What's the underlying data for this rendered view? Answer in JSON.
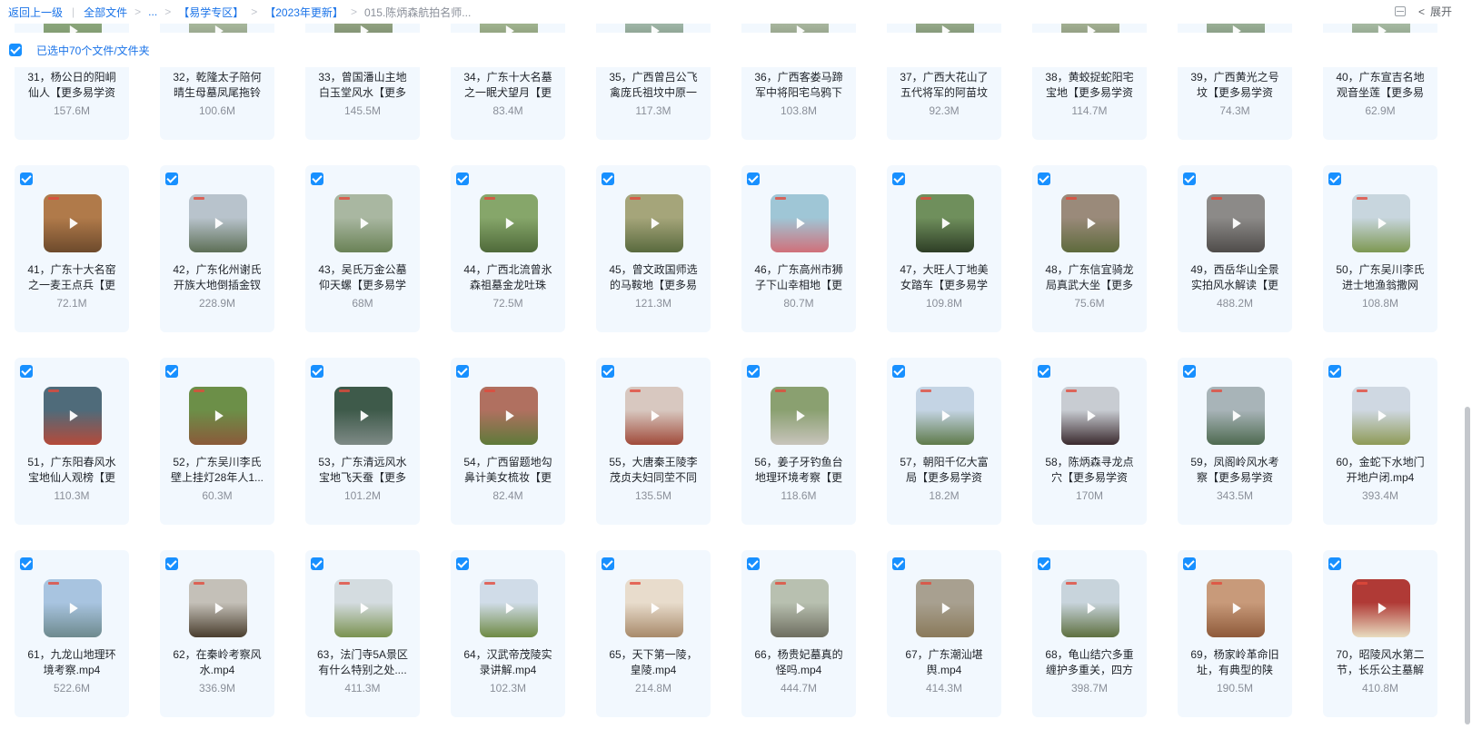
{
  "breadcrumb": {
    "back": "返回上一级",
    "all_files": "全部文件",
    "ellipsis": "...",
    "folder1": "【易学专区】",
    "folder2": "【2023年更新】",
    "current": "015.陈炳森航拍名师..."
  },
  "toolbar": {
    "expand_label": "展开",
    "list_icon": "list-view-icon",
    "chevron_icon": "chevron-left-icon"
  },
  "selection": {
    "label": "已选中70个文件/文件夹"
  },
  "icons": {
    "checkbox": "check-icon",
    "play": "play-icon"
  },
  "files": [
    {
      "name": "31，杨公日的阳峒仙人【更多易学资",
      "size": "157.6M",
      "colors": [
        "#8aa57a",
        "#6b7d5a"
      ]
    },
    {
      "name": "32，乾隆太子陪何晴生母墓凤尾拖铃",
      "size": "100.6M",
      "colors": [
        "#a5b59a",
        "#777e6c"
      ]
    },
    {
      "name": "33，曾国潘山主地白玉堂风水【更多",
      "size": "145.5M",
      "colors": [
        "#8fa07f",
        "#5d6b52"
      ]
    },
    {
      "name": "34，广东十大名墓之一眠犬望月【更",
      "size": "83.4M",
      "colors": [
        "#9eb18d",
        "#6c7a58"
      ]
    },
    {
      "name": "35，广西曾吕公飞禽庞氏祖坟中原一",
      "size": "117.3M",
      "colors": [
        "#9db4a5",
        "#627560"
      ]
    },
    {
      "name": "36，广西客娄马蹄军中将阳宅乌鸦下",
      "size": "103.8M",
      "colors": [
        "#a6b49c",
        "#6f7b64"
      ]
    },
    {
      "name": "37，广西大花山了五代将军的阿苗坟",
      "size": "92.3M",
      "colors": [
        "#93a787",
        "#5a6a50"
      ]
    },
    {
      "name": "38，黄蛟捉蛇阳宅宝地【更多易学资",
      "size": "114.7M",
      "colors": [
        "#a0ad90",
        "#6a735c"
      ]
    },
    {
      "name": "39，广西黄光之号坟【更多易学资",
      "size": "74.3M",
      "colors": [
        "#98ad94",
        "#60725e"
      ]
    },
    {
      "name": "40，广东宣吉名地观音坐莲【更多易",
      "size": "62.9M",
      "colors": [
        "#a4b8a0",
        "#6d7d68"
      ]
    },
    {
      "name": "41，广东十大名窑之一麦王点兵【更",
      "size": "72.1M",
      "colors": [
        "#b07a4a",
        "#6d4a2c"
      ]
    },
    {
      "name": "42，广东化州谢氏开族大地倒插金钗",
      "size": "228.9M",
      "colors": [
        "#b8c3cc",
        "#5d6f56"
      ]
    },
    {
      "name": "43，吴氏万金公墓仰天螺【更多易学",
      "size": "68M",
      "colors": [
        "#a9b7a1",
        "#6a8256"
      ]
    },
    {
      "name": "44，广西北流曾氷森祖墓金龙吐珠",
      "size": "72.5M",
      "colors": [
        "#86a66a",
        "#4f6a3a"
      ]
    },
    {
      "name": "45，曾文政国师选的马鞍地【更多易",
      "size": "121.3M",
      "colors": [
        "#a5a57a",
        "#596a3e"
      ]
    },
    {
      "name": "46，广东高州市狮子下山幸相地【更",
      "size": "80.7M",
      "colors": [
        "#9fc6d6",
        "#d0707a"
      ]
    },
    {
      "name": "47，大旺人丁地美女踏车【更多易学",
      "size": "109.8M",
      "colors": [
        "#6f8f5c",
        "#2e3e26"
      ]
    },
    {
      "name": "48，广东信宜骑龙局真武大坐【更多",
      "size": "75.6M",
      "colors": [
        "#9a8a7a",
        "#5e6a3c"
      ]
    },
    {
      "name": "49，西岳华山全景实拍风水解读【更",
      "size": "488.2M",
      "colors": [
        "#8c8a88",
        "#4f4c4a"
      ]
    },
    {
      "name": "50，广东吴川李氏进士地渔翁撒网",
      "size": "108.8M",
      "colors": [
        "#c8d6de",
        "#7d9852"
      ]
    },
    {
      "name": "51，广东阳春风水宝地仙人观榜【更",
      "size": "110.3M",
      "colors": [
        "#4f6b7a",
        "#b54a3a"
      ]
    },
    {
      "name": "52，广东吴川李氏壁上挂灯28年人1...",
      "size": "60.3M",
      "colors": [
        "#6c8f48",
        "#8a5a3a"
      ]
    },
    {
      "name": "53，广东清远风水宝地飞天蚕【更多",
      "size": "101.2M",
      "colors": [
        "#3e5a4a",
        "#7e8a86"
      ]
    },
    {
      "name": "54，广西留题地勾鼻计美女梳妆【更",
      "size": "82.4M",
      "colors": [
        "#b07060",
        "#5e7a3a"
      ]
    },
    {
      "name": "55，大唐秦王陵李茂贞夫妇同茔不同",
      "size": "135.5M",
      "colors": [
        "#d8c8c0",
        "#a04a3a"
      ]
    },
    {
      "name": "56，姜子牙钓鱼台地理环境考察【更",
      "size": "118.6M",
      "colors": [
        "#8aa070",
        "#c8c4bc"
      ]
    },
    {
      "name": "57，朝阳千亿大富局【更多易学资",
      "size": "18.2M",
      "colors": [
        "#c4d4e4",
        "#5e7a4a"
      ]
    },
    {
      "name": "58，陈炳森寻龙点穴【更多易学资",
      "size": "170M",
      "colors": [
        "#c8ccd2",
        "#3a2a2e"
      ]
    },
    {
      "name": "59，凤阁岭风水考察【更多易学资",
      "size": "343.5M",
      "colors": [
        "#a8b4b8",
        "#4e6a50"
      ]
    },
    {
      "name": "60，金蛇下水地门开地户闭.mp4",
      "size": "393.4M",
      "colors": [
        "#cfd8e2",
        "#8e9a56"
      ]
    },
    {
      "name": "61，九龙山地理环境考察.mp4",
      "size": "522.6M",
      "colors": [
        "#a8c4e0",
        "#6e8a8e"
      ]
    },
    {
      "name": "62，在秦岭考察风水.mp4",
      "size": "336.9M",
      "colors": [
        "#c4c0b8",
        "#4a3e2e"
      ]
    },
    {
      "name": "63，法门寺5A景区有什么特别之处....",
      "size": "411.3M",
      "colors": [
        "#d4dce0",
        "#7a9250"
      ]
    },
    {
      "name": "64，汉武帝茂陵实录讲解.mp4",
      "size": "102.3M",
      "colors": [
        "#d0dce8",
        "#6e8a44"
      ]
    },
    {
      "name": "65，天下第一陵，皇陵.mp4",
      "size": "214.8M",
      "colors": [
        "#e8dccc",
        "#a88a6a"
      ]
    },
    {
      "name": "66，杨贵妃墓真的怪吗.mp4",
      "size": "444.7M",
      "colors": [
        "#b8c0b0",
        "#6e6e60"
      ]
    },
    {
      "name": "67，广东潮汕堪舆.mp4",
      "size": "414.3M",
      "colors": [
        "#a8a090",
        "#8a7a5a"
      ]
    },
    {
      "name": "68，龟山结穴多重缠护多重关，四方",
      "size": "398.7M",
      "colors": [
        "#c8d4dc",
        "#5e7040"
      ]
    },
    {
      "name": "69，杨家岭革命旧址，有典型的陕",
      "size": "190.5M",
      "colors": [
        "#c89a7a",
        "#8e5a3a"
      ]
    },
    {
      "name": "70，昭陵风水第二节，长乐公主墓解",
      "size": "410.8M",
      "colors": [
        "#b03a36",
        "#e8dcc0"
      ]
    }
  ]
}
